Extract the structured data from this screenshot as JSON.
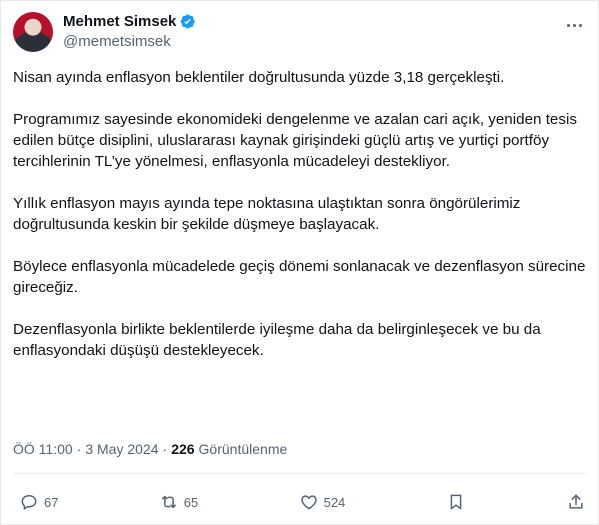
{
  "author": {
    "display_name": "Mehmet Simsek",
    "handle": "@memetsimsek",
    "verified_icon": "verified-badge-icon"
  },
  "tweet": {
    "paragraphs": [
      "Nisan ayında enflasyon beklentiler doğrultusunda yüzde 3,18 gerçekleşti.",
      "Programımız sayesinde ekonomideki dengelenme ve azalan cari açık, yeniden tesis edilen bütçe disiplini, uluslararası kaynak girişindeki güçlü artış ve yurtiçi portföy tercihlerinin TL’ye yönelmesi, enflasyonla mücadeleyi destekliyor.",
      "Yıllık enflasyon mayıs ayında tepe noktasına ulaştıktan sonra öngörülerimiz doğrultusunda keskin bir şekilde düşmeye başlayacak.",
      "Böylece enflasyonla mücadelede geçiş dönemi sonlanacak ve dezenflasyon sürecine gireceğiz.",
      "Dezenflasyonla birlikte beklentilerde iyileşme daha da belirginleşecek ve bu da enflasyondaki düşüşü destekleyecek."
    ],
    "time": "ÖÖ 11:00",
    "date": "3 May 2024",
    "separator": "·",
    "views_count": "226",
    "views_label": "Görüntülenme"
  },
  "actions": {
    "replies": "67",
    "reposts": "65",
    "likes": "524"
  },
  "colors": {
    "text": "#0f1419",
    "secondary": "#536471",
    "verified": "#1d9bf0",
    "border": "#e7e9ea"
  }
}
